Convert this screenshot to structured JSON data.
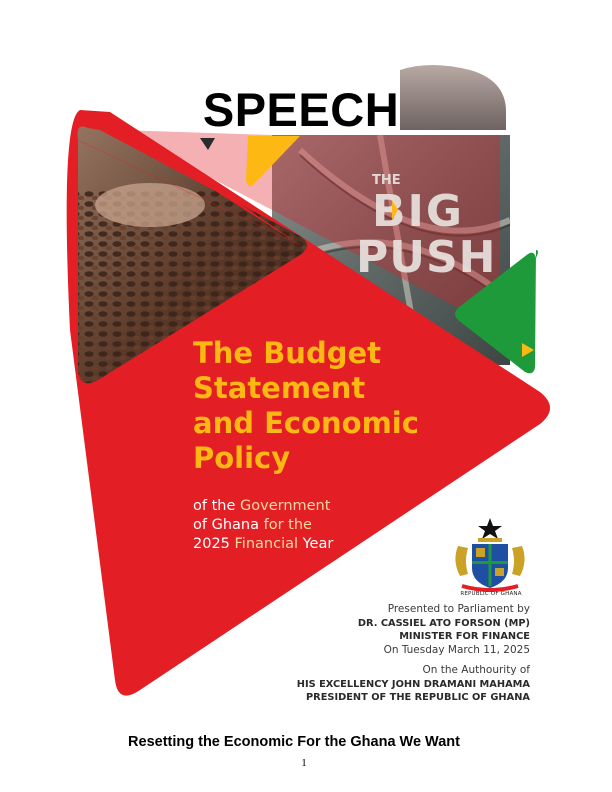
{
  "heading": "SPEECH",
  "cover": {
    "logo_lines": [
      "THE",
      "BIG",
      "PUSH"
    ],
    "title_lines": [
      "The Budget",
      "Statement",
      "and Economic",
      "Policy"
    ],
    "subtitle_lines": [
      {
        "a": "of the ",
        "b": "Government"
      },
      {
        "a": "of Ghana",
        "b": " for the"
      },
      {
        "a": "2025 ",
        "b": "Financial",
        "c": " Year"
      }
    ],
    "crest_caption": "REPUBLIC OF GHANA",
    "presented_by": "Presented to Parliament by",
    "presenter": "DR. CASSIEL ATO FORSON (MP)",
    "presenter_role": "MINISTER FOR FINANCE",
    "date_line": "On Tuesday March 11, 2025",
    "authority": "On the Authourity of",
    "president": "HIS EXCELLENCY JOHN DRAMANI MAHAMA",
    "president_role": "PRESIDENT OF THE REPUBLIC OF GHANA"
  },
  "tagline": "Resetting the Economic For the Ghana We Want",
  "page_number": "1",
  "colors": {
    "red": "#E31E24",
    "gold": "#FDB813",
    "green": "#1E9A3A",
    "dark_red": "#8B1A1A"
  }
}
